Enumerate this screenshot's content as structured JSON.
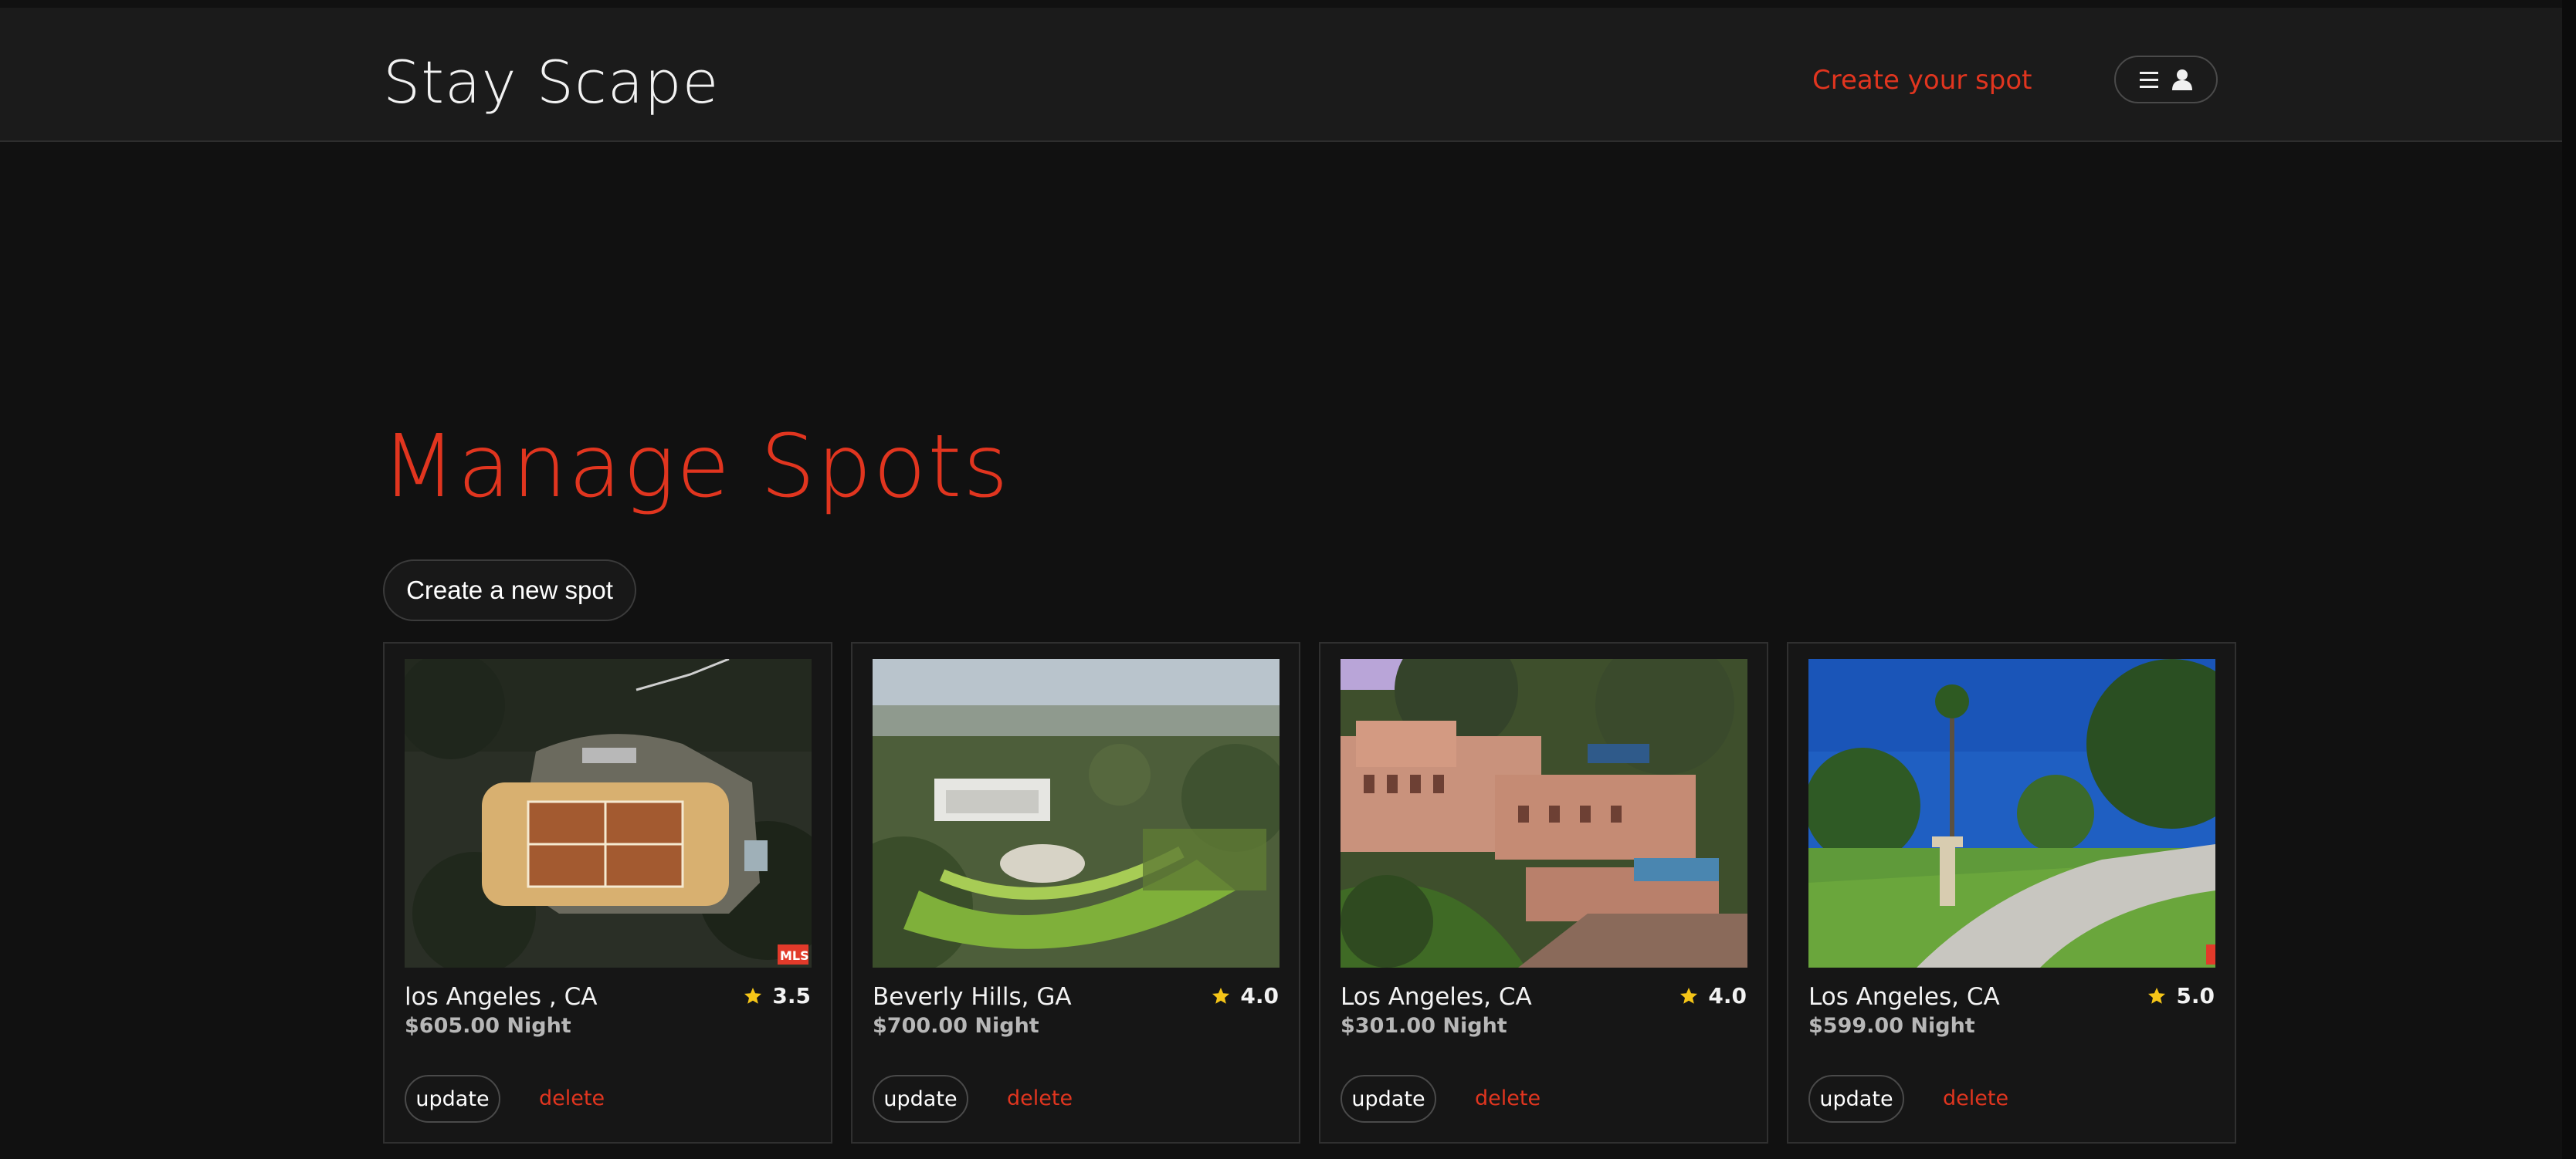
{
  "header": {
    "logo": "Stay Scape",
    "create_link": "Create your spot",
    "menu_icon": "hamburger-icon",
    "user_icon": "user-icon"
  },
  "main": {
    "title": "Manage Spots",
    "new_spot_button": "Create a new spot"
  },
  "spots": [
    {
      "location": "los Angeles , CA",
      "rating": "3.5",
      "price": "$605.00",
      "price_unit": "Night",
      "update_label": "update",
      "delete_label": "delete",
      "image": "aerial-tennis-court-estate"
    },
    {
      "location": "Beverly Hills, GA",
      "rating": "4.0",
      "price": "$700.00",
      "price_unit": "Night",
      "update_label": "update",
      "delete_label": "delete",
      "image": "hillside-modern-estate"
    },
    {
      "location": "Los Angeles, CA",
      "rating": "4.0",
      "price": "$301.00",
      "price_unit": "Night",
      "update_label": "update",
      "delete_label": "delete",
      "image": "terraced-villa"
    },
    {
      "location": "Los Angeles, CA",
      "rating": "5.0",
      "price": "$599.00",
      "price_unit": "Night",
      "update_label": "update",
      "delete_label": "delete",
      "image": "palm-driveway-lawn"
    }
  ],
  "colors": {
    "accent": "#e1351f",
    "background": "#111111",
    "header_bg": "#1b1b1b",
    "star": "#f5c518"
  },
  "image_watermark": "MLS"
}
